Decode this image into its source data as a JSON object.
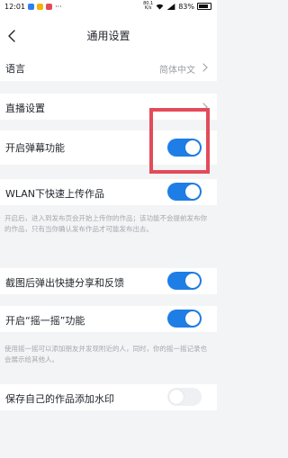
{
  "status_bar": {
    "time": "12:01",
    "network_speed_value": "80.1",
    "network_speed_unit": "K/s",
    "battery": "83%"
  },
  "header": {
    "title": "通用设置"
  },
  "settings": {
    "language": {
      "label": "语言",
      "value": "简体中文"
    },
    "live_settings": {
      "label": "直播设置"
    },
    "danmu": {
      "label": "开启弹幕功能",
      "on": true
    },
    "wlan_upload": {
      "label": "WLAN下快速上传作品",
      "on": true,
      "description": "开启后，进入到发布页会开始上传你的作品；该功能不会提前发布你的作品，只有当你确认发布作品才可能发布出去。"
    },
    "screenshot_share": {
      "label": "截图后弹出快捷分享和反馈",
      "on": true
    },
    "shake": {
      "label": "开启“摇一摇”功能",
      "on": true,
      "description": "使用摇一摇可以添加朋友并发现附近的人，同时，你的摇一摇记录也会展示给其他人。"
    },
    "watermark": {
      "label": "保存自己的作品添加水印",
      "on": false
    }
  },
  "colors": {
    "toggle_on": "#1e7ee6",
    "toggle_off": "#eef0f3",
    "highlight": "#e34b5a"
  }
}
